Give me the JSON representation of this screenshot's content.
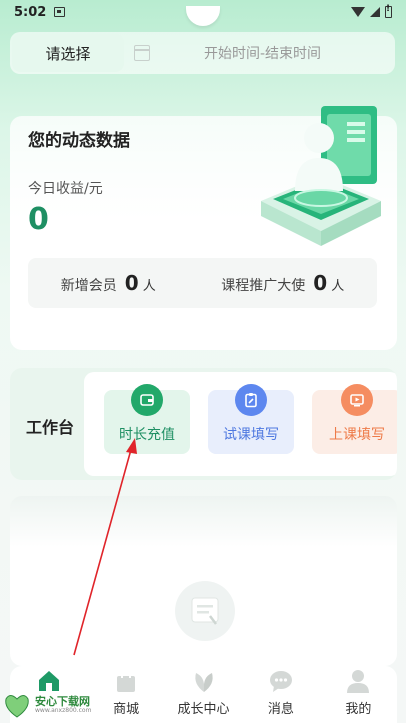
{
  "status_bar": {
    "time": "5:02"
  },
  "filter": {
    "select_label": "请选择",
    "date_range_placeholder": "开始时间-结束时间"
  },
  "dynamic_data": {
    "title": "您的动态数据",
    "earnings_label": "今日收益/元",
    "earnings_value": "0",
    "new_members_label": "新增会员",
    "new_members_value": "0",
    "new_members_unit": "人",
    "ambassadors_label": "课程推广大使",
    "ambassadors_value": "0",
    "ambassadors_unit": "人"
  },
  "workbench": {
    "label": "工作台",
    "tools": [
      {
        "label": "时长充值",
        "icon": "wallet-icon",
        "color": "#22a86a"
      },
      {
        "label": "试课填写",
        "icon": "clipboard-icon",
        "color": "#5d87ef"
      },
      {
        "label": "上课填写",
        "icon": "video-icon",
        "color": "#f58d61"
      }
    ]
  },
  "bottom_nav": {
    "items": [
      {
        "label": "",
        "icon": "home-icon",
        "active": true
      },
      {
        "label": "商城",
        "icon": "shopping-bag-icon"
      },
      {
        "label": "成长中心",
        "icon": "leaf-icon"
      },
      {
        "label": "消息",
        "icon": "chat-bubble-icon"
      },
      {
        "label": "我的",
        "icon": "person-icon"
      }
    ]
  },
  "watermark": {
    "text": "安心下载网",
    "url": "www.anxz800.com"
  }
}
